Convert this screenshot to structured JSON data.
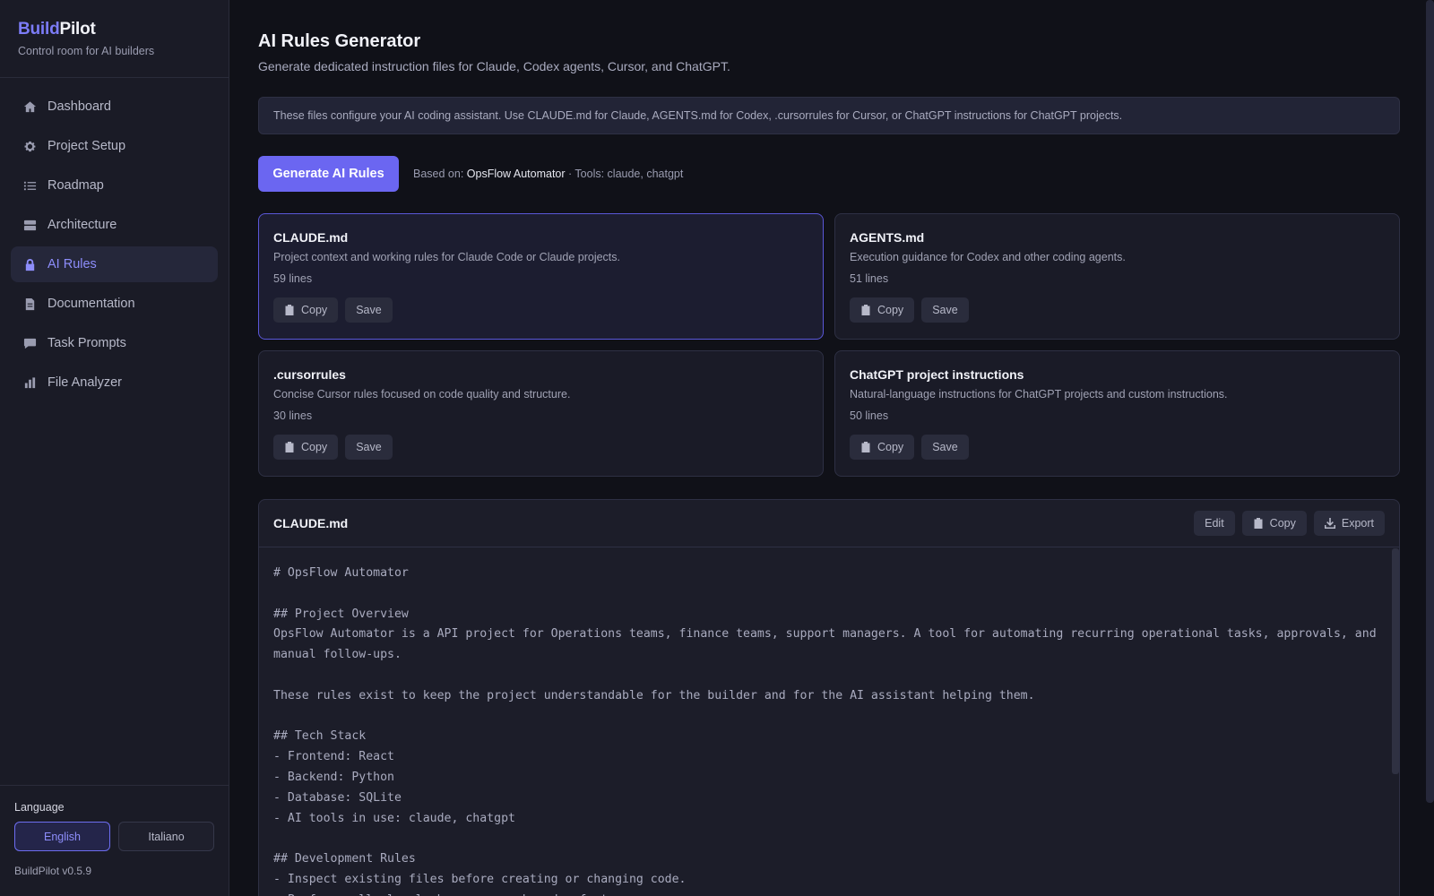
{
  "brand": {
    "part1": "Build",
    "part2": "Pilot",
    "subtitle": "Control room for AI builders"
  },
  "nav": [
    {
      "label": "Dashboard",
      "icon": "home-icon"
    },
    {
      "label": "Project Setup",
      "icon": "gear-icon"
    },
    {
      "label": "Roadmap",
      "icon": "list-icon"
    },
    {
      "label": "Architecture",
      "icon": "layers-icon"
    },
    {
      "label": "AI Rules",
      "icon": "lock-icon",
      "active": true
    },
    {
      "label": "Documentation",
      "icon": "document-icon"
    },
    {
      "label": "Task Prompts",
      "icon": "chat-icon"
    },
    {
      "label": "File Analyzer",
      "icon": "bar-chart-icon"
    }
  ],
  "language": {
    "label": "Language",
    "english": "English",
    "italiano": "Italiano",
    "selected": "English"
  },
  "version": "BuildPilot v0.5.9",
  "page": {
    "title": "AI Rules Generator",
    "subtitle": "Generate dedicated instruction files for Claude, Codex agents, Cursor, and ChatGPT.",
    "info": "These files configure your AI coding assistant. Use CLAUDE.md for Claude, AGENTS.md for Codex, .cursorrules for Cursor, or ChatGPT instructions for ChatGPT projects."
  },
  "generate": {
    "button": "Generate AI Rules",
    "based_prefix": "Based on: ",
    "project": "OpsFlow Automator",
    "tools": " · Tools: claude, chatgpt"
  },
  "cards": [
    {
      "title": "CLAUDE.md",
      "desc": "Project context and working rules for Claude Code or Claude projects.",
      "lines": "59 lines",
      "copy": "Copy",
      "save": "Save",
      "selected": true
    },
    {
      "title": "AGENTS.md",
      "desc": "Execution guidance for Codex and other coding agents.",
      "lines": "51 lines",
      "copy": "Copy",
      "save": "Save"
    },
    {
      "title": ".cursorrules",
      "desc": "Concise Cursor rules focused on code quality and structure.",
      "lines": "30 lines",
      "copy": "Copy",
      "save": "Save"
    },
    {
      "title": "ChatGPT project instructions",
      "desc": "Natural-language instructions for ChatGPT projects and custom instructions.",
      "lines": "50 lines",
      "copy": "Copy",
      "save": "Save"
    }
  ],
  "editor": {
    "title": "CLAUDE.md",
    "edit": "Edit",
    "copy": "Copy",
    "export": "Export",
    "content": "# OpsFlow Automator\n\n## Project Overview\nOpsFlow Automator is a API project for Operations teams, finance teams, support managers. A tool for automating recurring operational tasks, approvals, and manual follow-ups.\n\nThese rules exist to keep the project understandable for the builder and for the AI assistant helping them.\n\n## Tech Stack\n- Frontend: React\n- Backend: Python\n- Database: SQLite\n- AI tools in use: claude, chatgpt\n\n## Development Rules\n- Inspect existing files before creating or changing code.\n- Prefer small, local changes over broad refactors."
  },
  "colors": {
    "accent": "#6b66f1",
    "active_text": "#8d8dfb",
    "background": "#101118",
    "sidebar": "#1a1b26"
  }
}
